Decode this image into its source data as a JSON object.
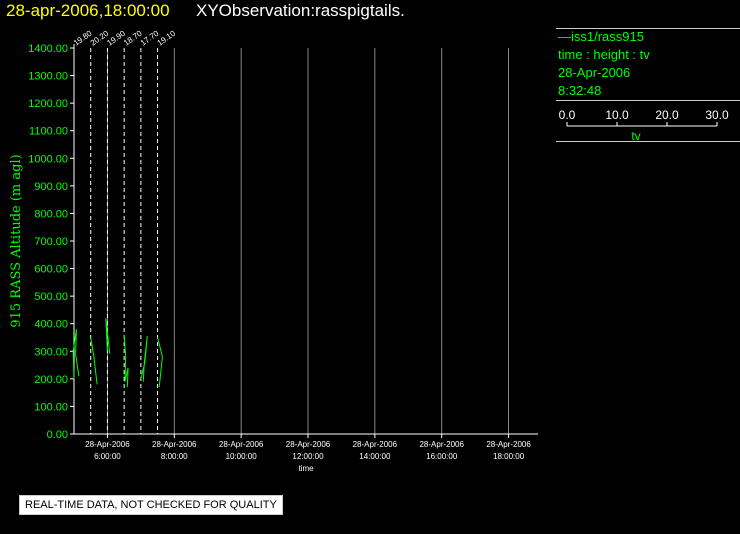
{
  "header": {
    "date_time": "28-apr-2006,18:00:00",
    "observation": "XYObservation:rasspigtails."
  },
  "legend": {
    "series_label": "—iss1/rass915",
    "variables": "time : height : tv",
    "date": "28-Apr-2006",
    "time": "8:32:48",
    "scale_ticks": [
      "0.0",
      "10.0",
      "20.0",
      "30.0"
    ],
    "scale_label": "tv"
  },
  "footer": {
    "quality_note": "REAL-TIME DATA, NOT CHECKED FOR QUALITY"
  },
  "colors": {
    "background": "#000000",
    "title_date": "#ffff00",
    "title_text": "#ffffff",
    "axis_label": "#00ff00",
    "data_line": "#00ff00",
    "axis": "#ffffff",
    "grid": "#aaaaaa"
  },
  "chart_data": {
    "type": "line",
    "title": "XYObservation:rasspigtails.",
    "xlabel": "time",
    "ylabel": "915 RASS Altitude (m agl)",
    "x_range": [
      "2006-04-28 05:00",
      "2006-04-28 19:00"
    ],
    "ylim": [
      0,
      1400
    ],
    "y_ticks": [
      "0.00",
      "100.00",
      "200.00",
      "300.00",
      "400.00",
      "500.00",
      "600.00",
      "700.00",
      "800.00",
      "900.00",
      "1000.00",
      "1100.00",
      "1200.00",
      "1300.00",
      "1400.00"
    ],
    "x_ticks": [
      {
        "date": "28-Apr-2006",
        "time": "6:00:00"
      },
      {
        "date": "28-Apr-2006",
        "time": "8:00:00"
      },
      {
        "date": "28-Apr-2006",
        "time": "10:00:00"
      },
      {
        "date": "28-Apr-2006",
        "time": "12:00:00"
      },
      {
        "date": "28-Apr-2006",
        "time": "14:00:00"
      },
      {
        "date": "28-Apr-2006",
        "time": "16:00:00"
      },
      {
        "date": "28-Apr-2006",
        "time": "18:00:00"
      }
    ],
    "grid": true,
    "profiles": [
      {
        "time": "2006-04-28 05:00",
        "label": "19.80",
        "points": [
          [
            0.0,
            200
          ],
          [
            -0.1,
            300
          ],
          [
            0.3,
            380
          ],
          [
            0.2,
            290
          ],
          [
            0.6,
            210
          ]
        ]
      },
      {
        "time": "2006-04-28 05:30",
        "label": "20.20",
        "points": [
          [
            0.0,
            350
          ],
          [
            0.4,
            280
          ],
          [
            0.8,
            180
          ]
        ]
      },
      {
        "time": "2006-04-28 06:00",
        "label": "19.90",
        "points": [
          [
            0.0,
            300
          ],
          [
            -0.2,
            420
          ],
          [
            0.3,
            290
          ]
        ]
      },
      {
        "time": "2006-04-28 06:30",
        "label": "18.70",
        "points": [
          [
            0.0,
            360
          ],
          [
            0.2,
            280
          ],
          [
            0.1,
            190
          ],
          [
            0.5,
            240
          ],
          [
            0.4,
            170
          ]
        ]
      },
      {
        "time": "2006-04-28 07:00",
        "label": "17.70",
        "points": [
          [
            0.0,
            200
          ],
          [
            0.5,
            260
          ],
          [
            0.8,
            355
          ],
          [
            0.4,
            250
          ],
          [
            0.3,
            190
          ]
        ]
      },
      {
        "time": "2006-04-28 07:30",
        "label": "19.10",
        "points": [
          [
            0.0,
            350
          ],
          [
            0.6,
            280
          ],
          [
            0.2,
            170
          ]
        ]
      }
    ]
  }
}
